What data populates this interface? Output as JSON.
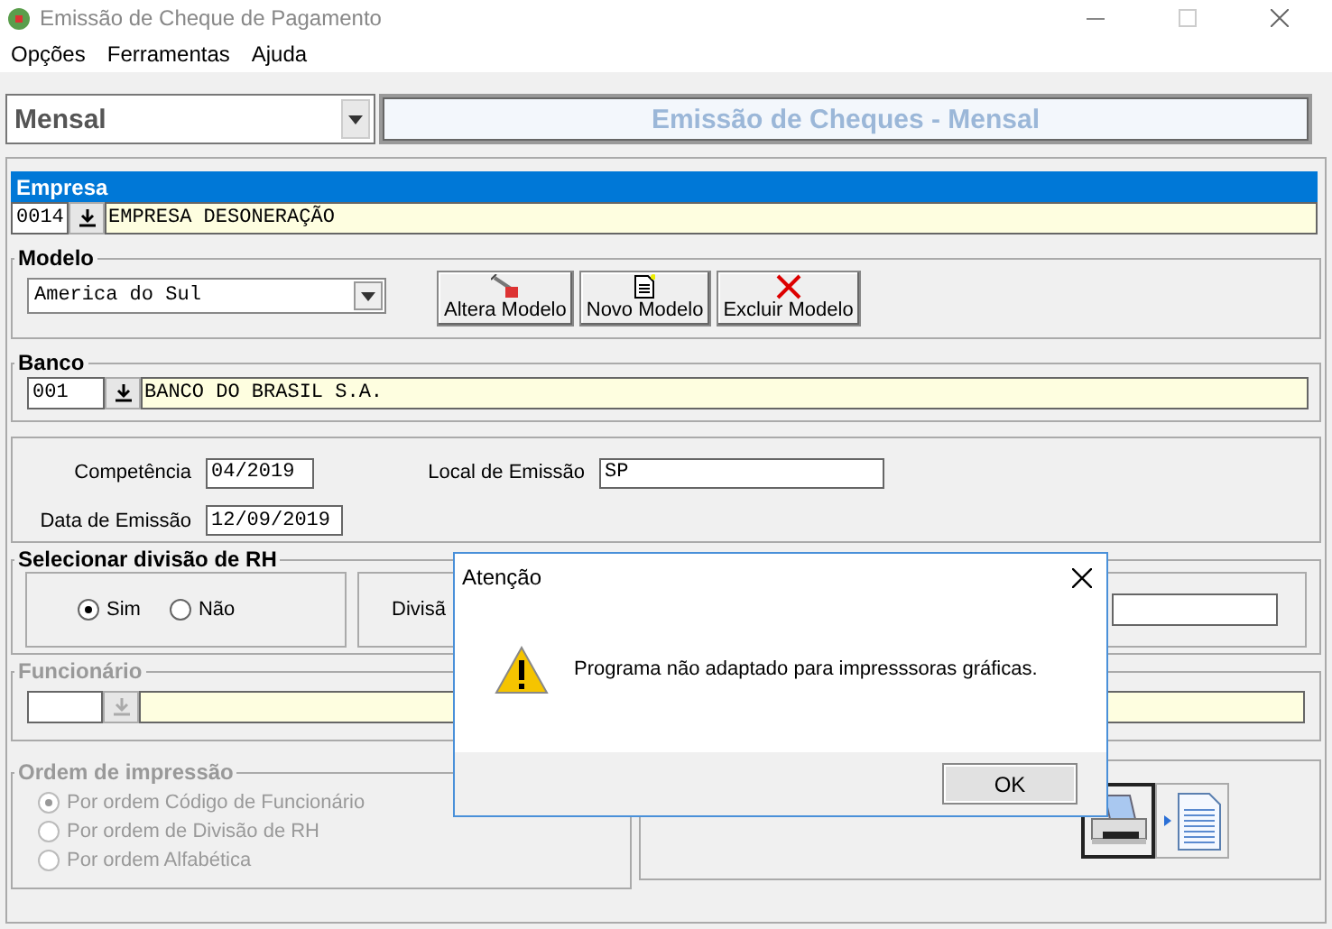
{
  "window": {
    "title": "Emissão de Cheque de Pagamento"
  },
  "menu": [
    "Opções",
    "Ferramentas",
    "Ajuda"
  ],
  "period_select": {
    "value": "Mensal"
  },
  "heading": "Emissão de Cheques - Mensal",
  "empresa": {
    "label": "Empresa",
    "code": "0014",
    "name": "EMPRESA DESONERAÇÃO"
  },
  "modelo": {
    "label": "Modelo",
    "value": "America do Sul",
    "buttons": [
      {
        "kind": "edit",
        "label": "Altera Modelo"
      },
      {
        "kind": "new",
        "label": "Novo Modelo"
      },
      {
        "kind": "delete",
        "label": "Excluir Modelo"
      }
    ]
  },
  "banco": {
    "label": "Banco",
    "code": "001",
    "name": "BANCO DO BRASIL S.A."
  },
  "dates": {
    "fields": [
      {
        "label": "Competência",
        "value": "04/2019"
      },
      {
        "label": "Data de Emissão",
        "value": "12/09/2019"
      }
    ],
    "local": {
      "label": "Local de Emissão",
      "value": "SP"
    }
  },
  "divisao": {
    "label": "Selecionar divisão de RH",
    "options": [
      {
        "label": "Sim",
        "selected": true
      },
      {
        "label": "Não",
        "selected": false
      }
    ],
    "field_label": "Divisã"
  },
  "funcionario": {
    "label": "Funcionário",
    "disabled": true
  },
  "ordem": {
    "label": "Ordem de impressão",
    "disabled": true,
    "options": [
      {
        "label": "Por ordem Código de Funcionário",
        "selected": true
      },
      {
        "label": "Por ordem de Divisão de RH",
        "selected": false
      },
      {
        "label": "Por ordem Alfabética",
        "selected": false
      }
    ]
  },
  "output_buttons": [
    {
      "kind": "printer",
      "selected": true
    },
    {
      "kind": "file",
      "selected": false
    }
  ],
  "dialog": {
    "title": "Atenção",
    "message": "Programa não adaptado para impresssoras gráficas.",
    "button": "OK"
  }
}
